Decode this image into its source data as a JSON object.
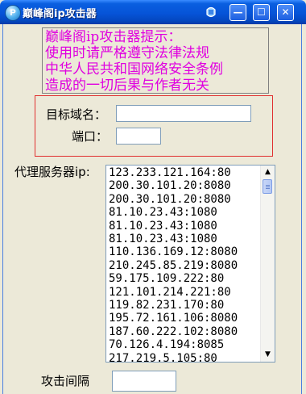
{
  "window": {
    "title": "巅峰阁ip攻击器",
    "icon_letter": "P",
    "minimize_glyph": "—",
    "maximize_glyph": "☐",
    "close_glyph": "✕"
  },
  "warning": {
    "lines": [
      "巅峰阁ip攻击器提示：",
      "使用时请严格遵守法律法规",
      "中华人民共和国网络安全条例",
      "造成的一切后果与作者无关"
    ],
    "color": "#e000e0"
  },
  "target": {
    "domain_label": "目标域名：",
    "domain_value": "",
    "port_label": "端口：",
    "port_value": ""
  },
  "proxy": {
    "label": "代理服务器ip:",
    "servers": [
      "123.233.121.164:80",
      "200.30.101.20:8080",
      "200.30.101.20:8080",
      "81.10.23.43:1080",
      "81.10.23.43:1080",
      "81.10.23.43:1080",
      "110.136.169.12:8080",
      "210.245.85.219:8080",
      "59.175.109.222:80",
      "121.101.214.221:80",
      "119.82.231.170:80",
      "195.72.161.106:8080",
      "187.60.222.102:8080",
      "70.126.4.194:8085",
      "217.219.5.105:80"
    ]
  },
  "interval": {
    "label": "攻击间隔",
    "value": ""
  },
  "colors": {
    "titlebar": "#0654d8",
    "target_border": "#e03030"
  }
}
